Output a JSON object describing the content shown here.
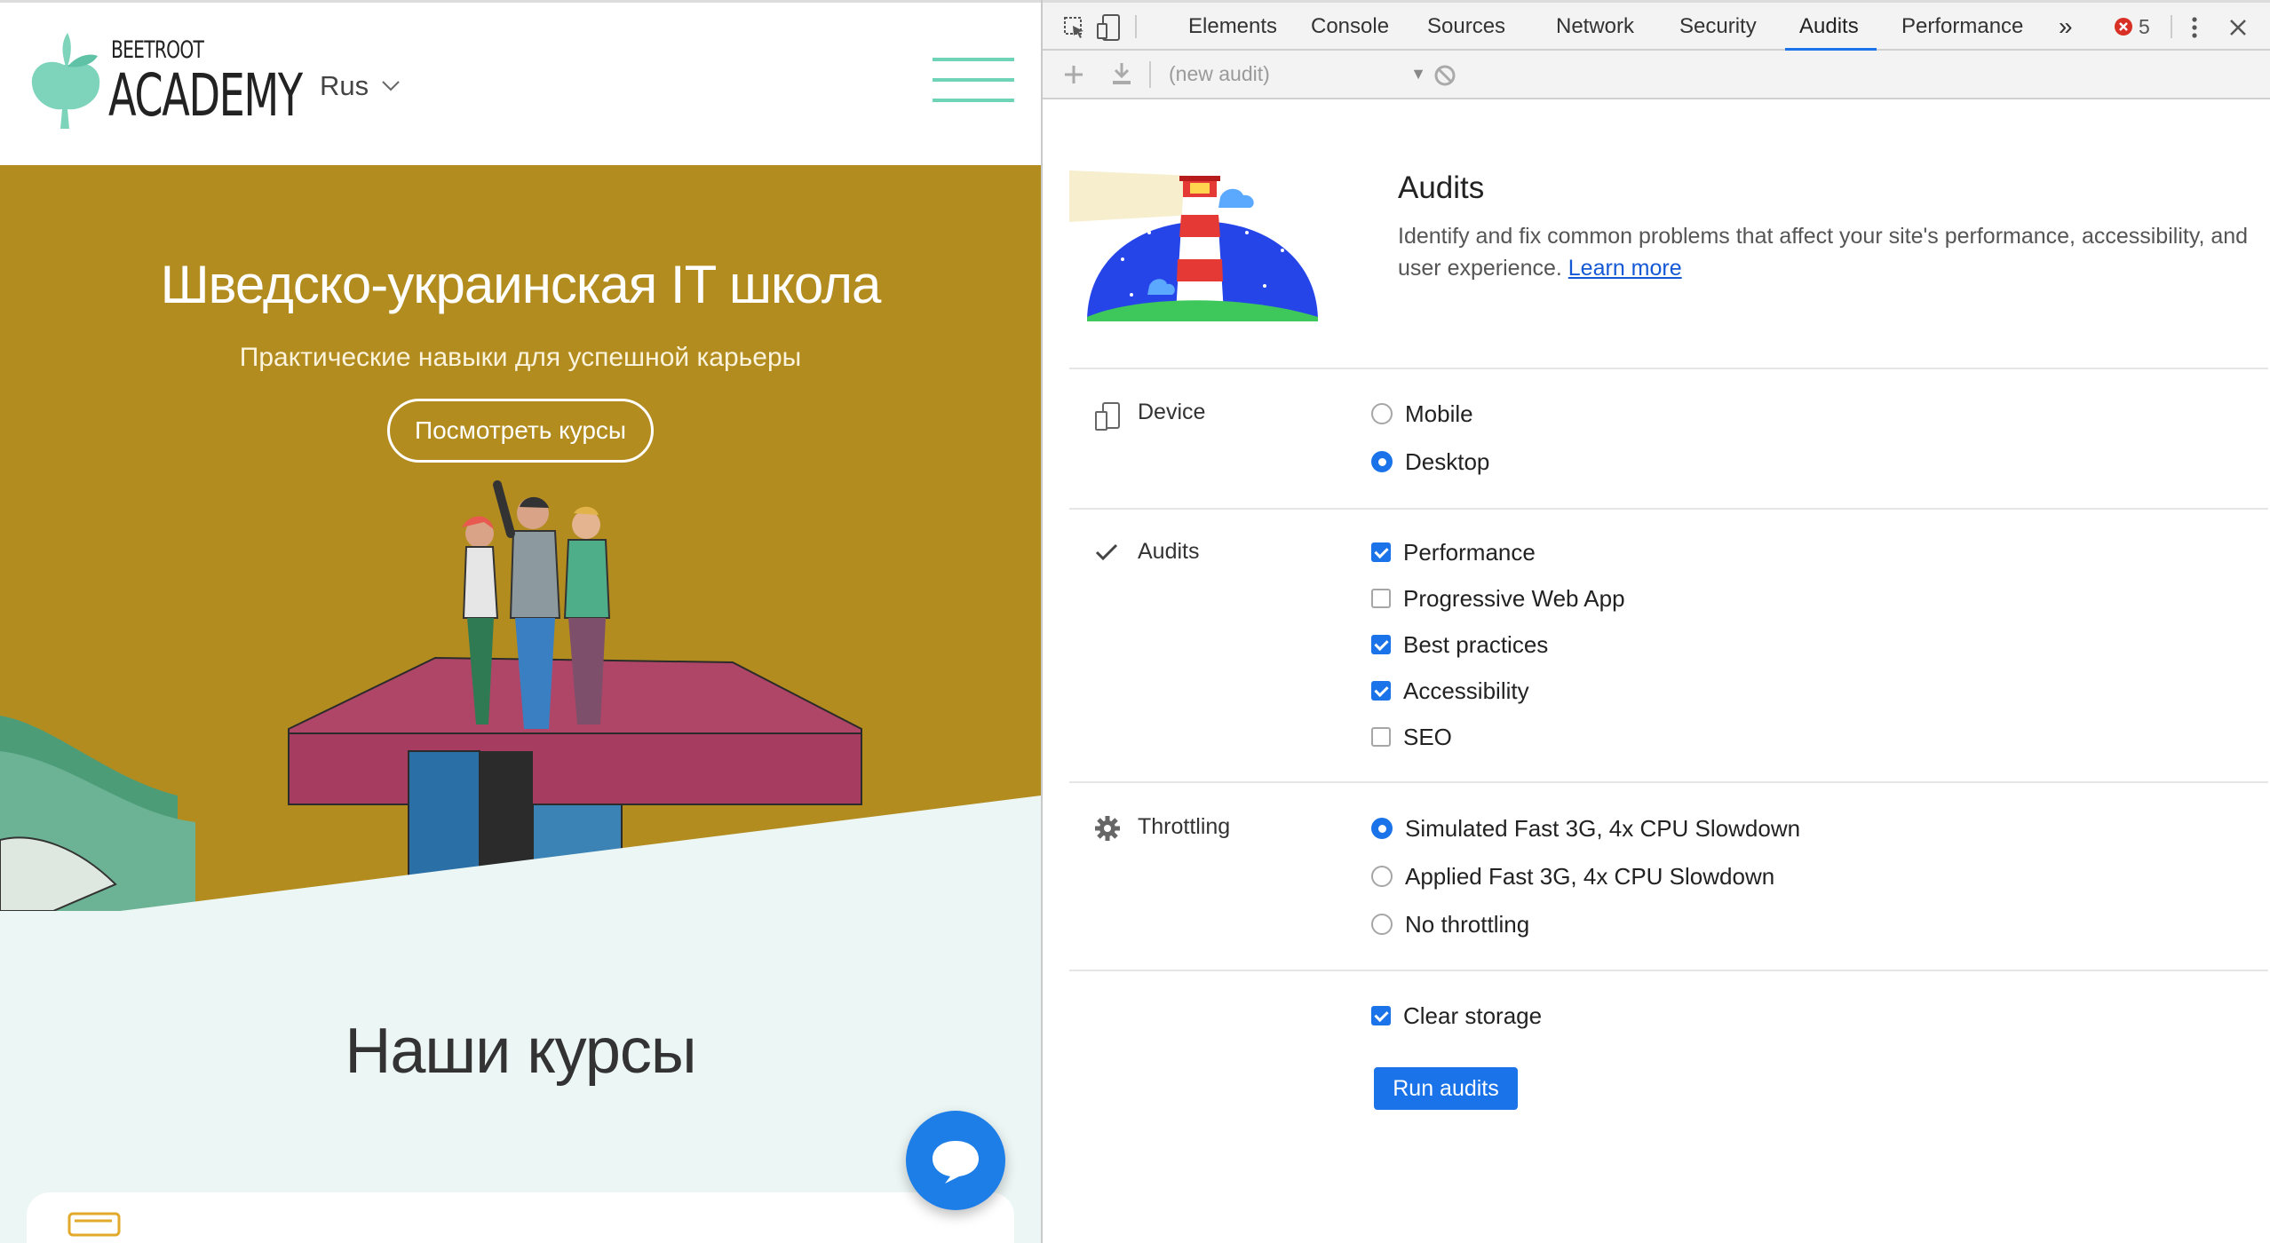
{
  "site": {
    "logo_small": "BEETROOT",
    "logo_big": "ACADEMY",
    "language": "Rus",
    "hero_title": "Шведско-украинская IT школа",
    "hero_subtitle": "Практические навыки для успешной карьеры",
    "hero_button": "Посмотреть курсы",
    "courses_title": "Наши курсы",
    "colors": {
      "accent": "#6fd3b8",
      "hero_bg": "#b38c1f",
      "chat": "#1e7ee8"
    }
  },
  "devtools": {
    "tabs": [
      "Elements",
      "Console",
      "Sources",
      "Network",
      "Security",
      "Audits",
      "Performance"
    ],
    "active_tab": "Audits",
    "overflow": "»",
    "error_count": "5",
    "audit_select": "(new audit)",
    "header": {
      "title": "Audits",
      "description": "Identify and fix common problems that affect your site's performance, accessibility, and user experience.",
      "learn_more": "Learn more"
    },
    "device": {
      "label": "Device",
      "options": [
        {
          "label": "Mobile",
          "selected": false
        },
        {
          "label": "Desktop",
          "selected": true
        }
      ]
    },
    "audits": {
      "label": "Audits",
      "options": [
        {
          "label": "Performance",
          "checked": true
        },
        {
          "label": "Progressive Web App",
          "checked": false
        },
        {
          "label": "Best practices",
          "checked": true
        },
        {
          "label": "Accessibility",
          "checked": true
        },
        {
          "label": "SEO",
          "checked": false
        }
      ]
    },
    "throttling": {
      "label": "Throttling",
      "options": [
        {
          "label": "Simulated Fast 3G, 4x CPU Slowdown",
          "selected": true
        },
        {
          "label": "Applied Fast 3G, 4x CPU Slowdown",
          "selected": false
        },
        {
          "label": "No throttling",
          "selected": false
        }
      ]
    },
    "clear_storage": {
      "label": "Clear storage",
      "checked": true
    },
    "run_button": "Run audits",
    "colors": {
      "accent": "#1a73e8",
      "link": "#1558d6",
      "error": "#d93025"
    }
  }
}
